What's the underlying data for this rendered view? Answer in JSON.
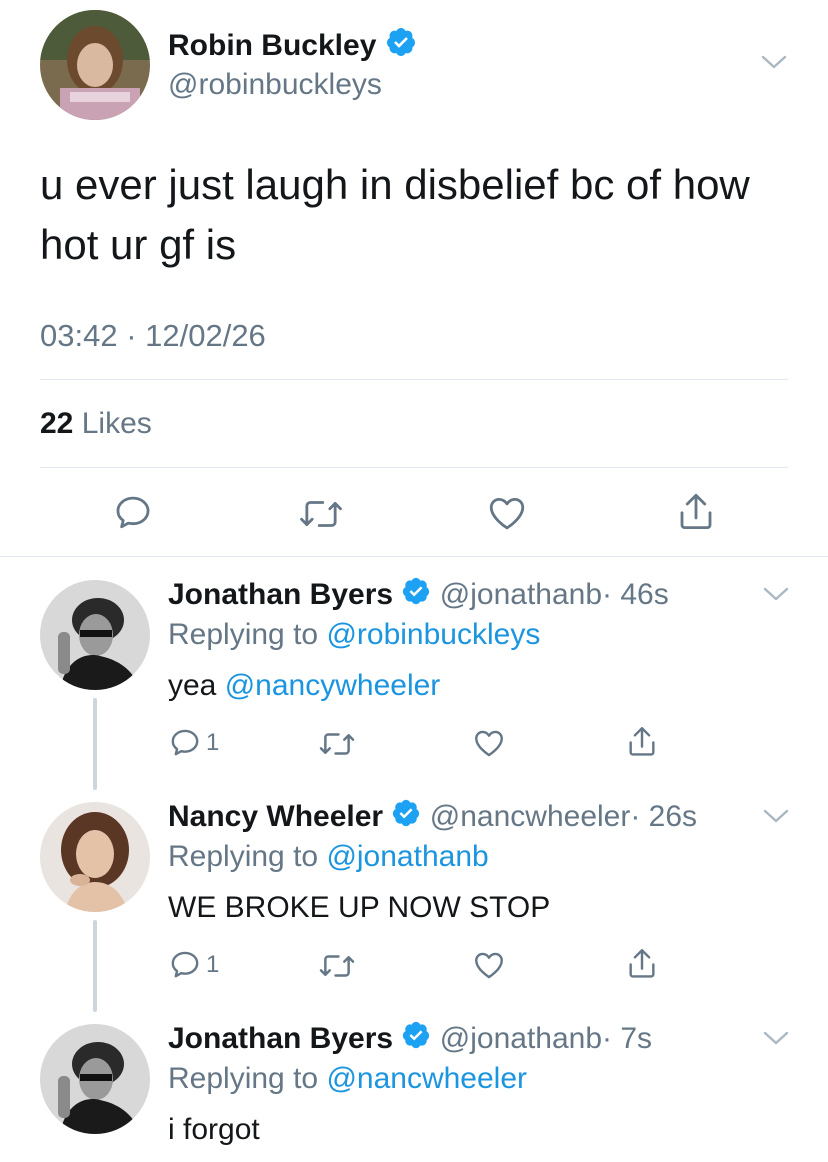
{
  "main_tweet": {
    "name": "Robin Buckley",
    "handle": "@robinbuckleys",
    "text": "u ever just laugh in disbelief bc of how hot ur gf is",
    "timestamp": "03:42 · 12/02/26",
    "likes_count": "22",
    "likes_label": "Likes",
    "avatar_icon": "avatar-photo"
  },
  "replies": [
    {
      "name": "Jonathan Byers",
      "handle": "@jonathanb",
      "time": "· 46s",
      "replying_label": "Replying to",
      "replying_to": "@robinbuckleys",
      "text": "yea",
      "mention": "@nancywheeler",
      "reply_count": "1"
    },
    {
      "name": "Nancy Wheeler",
      "handle": "@nancwheeler",
      "time": "· 26s",
      "replying_label": "Replying to",
      "replying_to": "@jonathanb",
      "text": "WE BROKE UP NOW STOP",
      "reply_count": "1"
    },
    {
      "name": "Jonathan Byers",
      "handle": "@jonathanb",
      "time": "· 7s",
      "replying_label": "Replying to",
      "replying_to": "@nancwheeler",
      "text": "i forgot"
    }
  ],
  "colors": {
    "accent": "#1b95e0",
    "verified": "#1da1f2",
    "text": "#14171a",
    "secondary": "#657786",
    "divider": "#e1e8ed"
  }
}
